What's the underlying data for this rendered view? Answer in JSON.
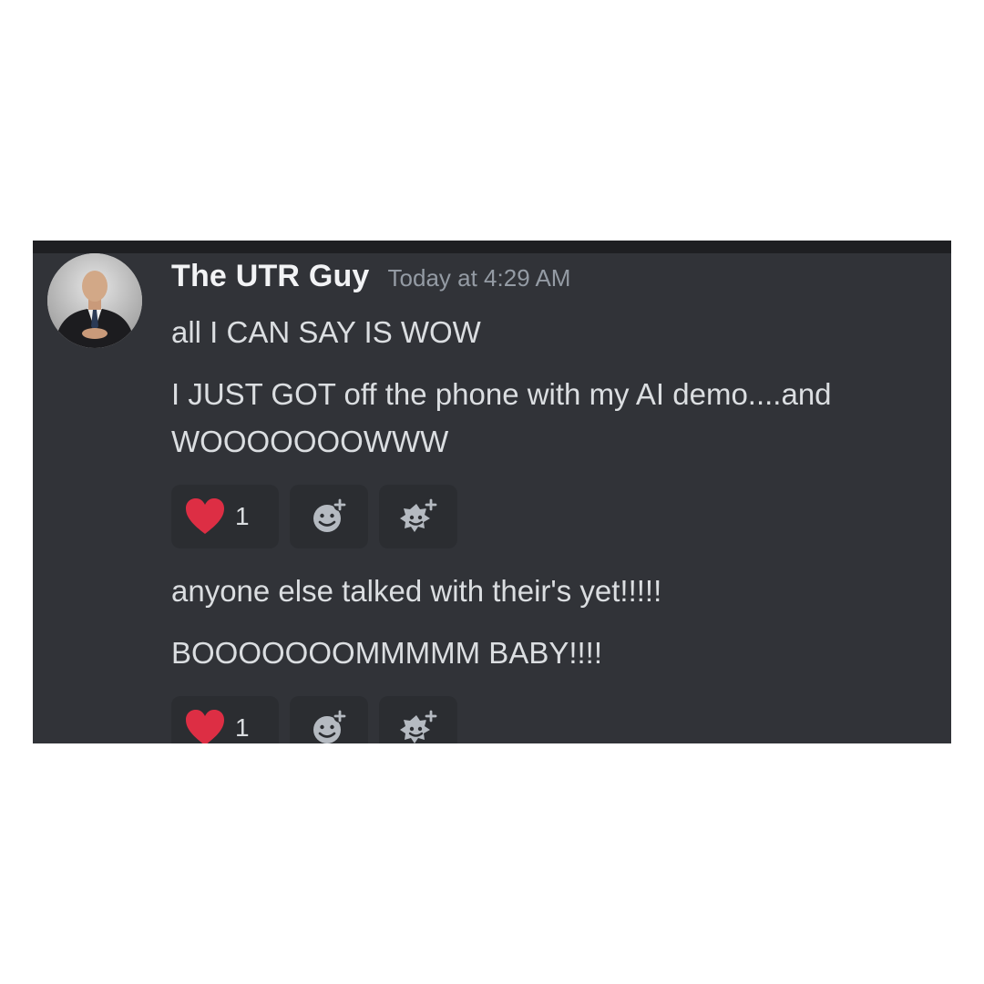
{
  "message": {
    "username": "The UTR Guy",
    "timestamp": "Today at 4:29 AM",
    "lines": [
      "all I CAN SAY IS WOW",
      "I JUST GOT off the phone with my AI demo....and",
      "WOOOOOOOWWW",
      "anyone else talked with their's yet!!!!!",
      "BOOOOOOOMMMMM BABY!!!!"
    ]
  },
  "reactions": [
    {
      "emoji": "heart-icon",
      "count": "1",
      "add_reaction_icon": "add-reaction-icon",
      "add_super_reaction_icon": "add-super-reaction-icon"
    },
    {
      "emoji": "heart-icon",
      "count": "1",
      "add_reaction_icon": "add-reaction-icon",
      "add_super_reaction_icon": "add-super-reaction-icon"
    }
  ],
  "colors": {
    "background": "#313338",
    "username": "#f2f3f5",
    "timestamp": "#949ba4",
    "text": "#dbdee1",
    "reaction_bg": "#2b2d31",
    "heart": "#dd2e44"
  }
}
